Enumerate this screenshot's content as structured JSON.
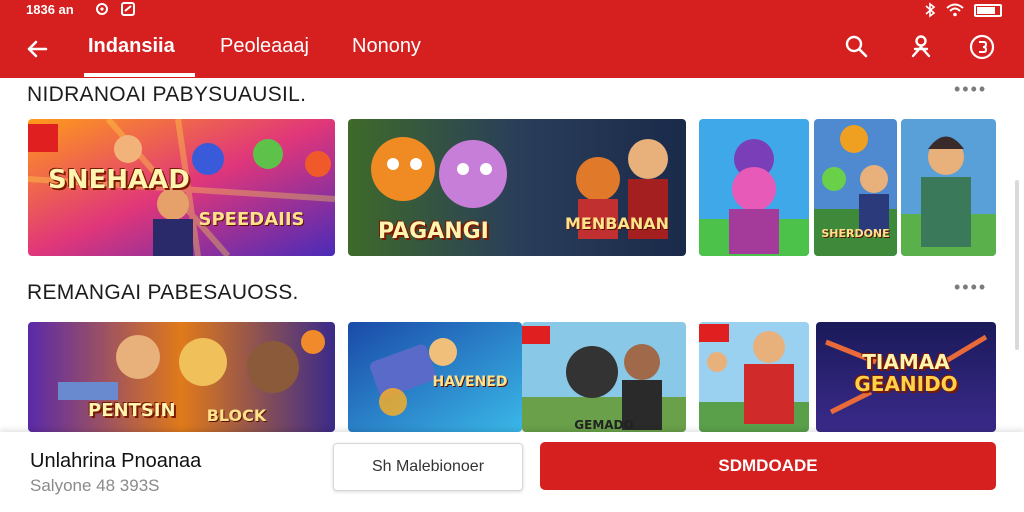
{
  "status_bar": {
    "time": "1836 an",
    "battery_level": 0.75,
    "icons": [
      "bluetooth-icon",
      "wifi-icon",
      "battery-icon"
    ]
  },
  "app_bar": {
    "tabs": [
      {
        "label": "Indansiia",
        "active": true
      },
      {
        "label": "Peoleaaaj",
        "active": false
      },
      {
        "label": "Nonony",
        "active": false
      }
    ],
    "icons": [
      "back-arrow-icon",
      "search-icon",
      "person-icon",
      "coin-icon"
    ]
  },
  "sections": [
    {
      "title": "NIDRANOAI PABYSUAUSIL.",
      "more": "••••",
      "cards": [
        {
          "caption": "SNEHAAD",
          "subcaption": "SPEEDAIIS"
        },
        {
          "caption": "PAGANGI",
          "subcaption": "MENBANAN"
        },
        {
          "caption": "",
          "subcaption": ""
        },
        {
          "caption": "",
          "subcaption": "SHERDONE"
        },
        {
          "caption": "",
          "subcaption": ""
        }
      ]
    },
    {
      "title": "REMANGAI PABESAUOSS.",
      "more": "••••",
      "cards": [
        {
          "caption": "PENTSIN",
          "subcaption": "BLOCK"
        },
        {
          "caption": "",
          "subcaption": "HAVENED"
        },
        {
          "caption": "",
          "subcaption": "GEMADO"
        },
        {
          "caption": "",
          "subcaption": ""
        },
        {
          "caption": "TIAMAA",
          "subcaption": "GEANIDO"
        }
      ]
    }
  ],
  "bottom_bar": {
    "app_name": "Unlahrina Pnoanaa",
    "app_meta": "Salyone 48 393S",
    "secondary_label": "Sh Malebionoer",
    "primary_label": "SDMDOADE"
  },
  "colors": {
    "brand_red": "#d61f1f",
    "background": "#ffffff",
    "text_dark": "#1c1c1c",
    "text_muted": "#8a8a8a"
  }
}
